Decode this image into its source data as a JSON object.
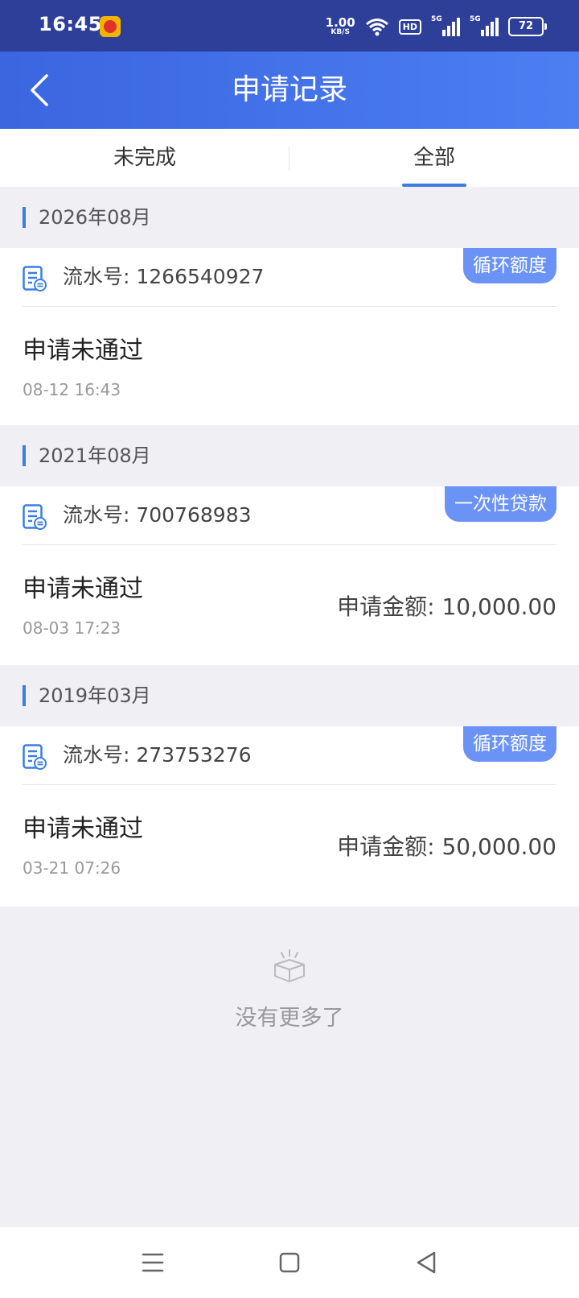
{
  "status_bar": {
    "time": "16:45",
    "net_speed_value": "1.00",
    "net_speed_unit": "KB/S",
    "hd_label": "HD",
    "signal_label_1": "5G",
    "signal_label_2": "5G",
    "battery": "72",
    "icons": [
      "app-notification-icon",
      "wifi-icon",
      "signal-icon",
      "battery-icon"
    ]
  },
  "header": {
    "title": "申请记录",
    "back_icon": "chevron-left-icon"
  },
  "tabs": [
    {
      "label": "未完成",
      "active": false
    },
    {
      "label": "全部",
      "active": true
    }
  ],
  "groups": [
    {
      "month": "2026年08月",
      "record": {
        "serial": "流水号: 1266540927",
        "tag": "循环额度",
        "status": "申请未通过",
        "time": "08-12 16:43",
        "amount": ""
      }
    },
    {
      "month": "2021年08月",
      "record": {
        "serial": "流水号: 700768983",
        "tag": "一次性贷款",
        "status": "申请未通过",
        "time": "08-03 17:23",
        "amount": "申请金额:  10,000.00"
      }
    },
    {
      "month": "2019年03月",
      "record": {
        "serial": "流水号: 273753276",
        "tag": "循环额度",
        "status": "申请未通过",
        "time": "03-21 07:26",
        "amount": "申请金额:  50,000.00"
      }
    }
  ],
  "empty_state": {
    "text": "没有更多了",
    "icon": "empty-box-icon"
  },
  "nav_bar": {
    "icons": [
      "menu-icon",
      "home-square-icon",
      "back-triangle-icon"
    ]
  },
  "colors": {
    "status_bar": "#2e3f9a",
    "header_gradient_start": "#3a66e0",
    "header_gradient_end": "#4d7ef2",
    "accent": "#3a7fe0",
    "tag": "#6b93f5",
    "background": "#efeff4"
  }
}
